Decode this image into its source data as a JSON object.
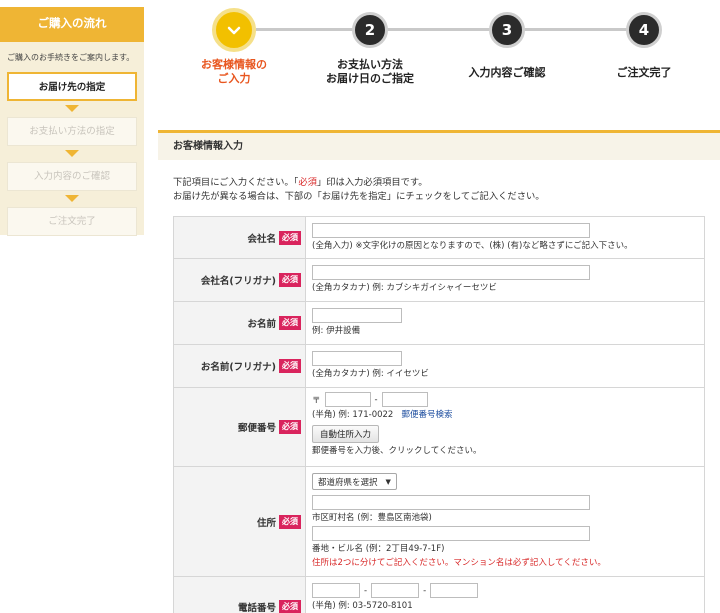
{
  "sidebar": {
    "title": "ご購入の流れ",
    "intro": "ご購入のお手続きをご案内します。",
    "steps": [
      "お届け先の指定",
      "お支払い方法の指定",
      "入力内容のご確認",
      "ご注文完了"
    ]
  },
  "progress": {
    "steps": [
      {
        "number": "",
        "line1": "お客様情報の",
        "line2": "ご入力"
      },
      {
        "number": "2",
        "line1": "お支払い方法",
        "line2": "お届け日のご指定"
      },
      {
        "number": "3",
        "line1": "入力内容ご確認",
        "line2": ""
      },
      {
        "number": "4",
        "line1": "ご注文完了",
        "line2": ""
      }
    ]
  },
  "section": {
    "title": "お客様情報入力",
    "intro_line1_a": "下記項目にご入力ください。「",
    "intro_line1_req": "必須",
    "intro_line1_b": "」印は入力必須項目です。",
    "intro_line2": "お届け先が異なる場合は、下部の「お届け先を指定」にチェックをしてご記入ください。"
  },
  "form": {
    "required": "必須",
    "company": {
      "label": "会社名",
      "note": "(全角入力) ※文字化けの原因となりますので、(株) (有)など略さずにご記入下さい。"
    },
    "company_kana": {
      "label": "会社名(フリガナ)",
      "note": "(全角カタカナ) 例: カブシキガイシャイーセツビ"
    },
    "name": {
      "label": "お名前",
      "note": "例: 伊井設備"
    },
    "name_kana": {
      "label": "お名前(フリガナ)",
      "note": "(全角カタカナ) 例: イイセツビ"
    },
    "zip": {
      "label": "郵便番号",
      "prefix": "〒",
      "dash": "-",
      "note": "(半角) 例: 171-0022",
      "search_link": "郵便番号検索",
      "auto_button": "自動住所入力",
      "auto_note": "郵便番号を入力後、クリックしてください。"
    },
    "address": {
      "label": "住所",
      "select_value": "都道府県を選択",
      "city_note": "市区町村名 (例：豊島区南池袋)",
      "street_note": "番地・ビル名 (例：2丁目49-7-1F)",
      "warning": "住所は2つに分けてご記入ください。マンション名は必ず記入してください。"
    },
    "phone": {
      "label": "電話番号",
      "dash": "-",
      "note": "(半角) 例: 03-5720-8101"
    }
  }
}
